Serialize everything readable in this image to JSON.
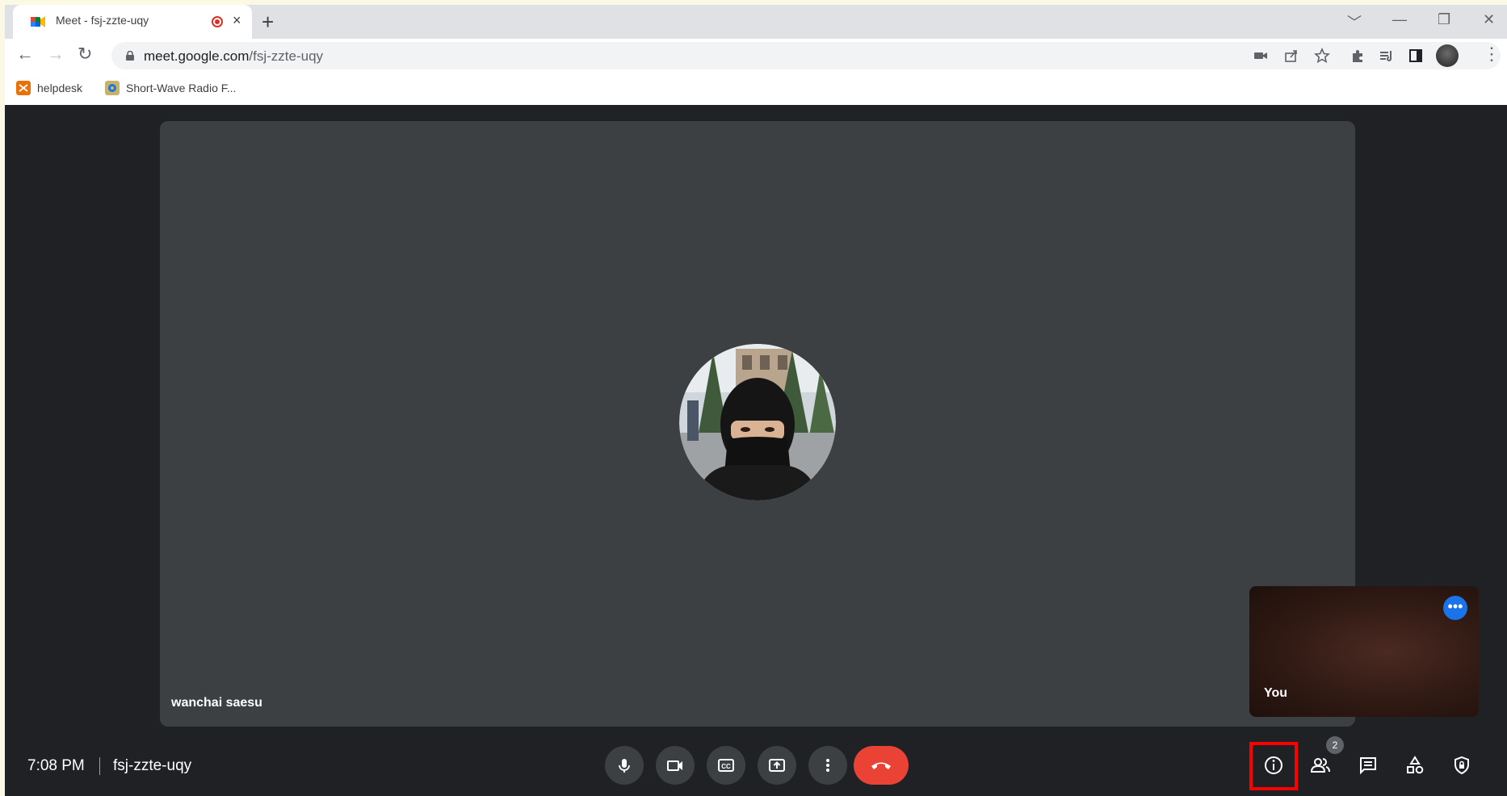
{
  "browser": {
    "tab_title": "Meet - fsj-zzte-uqy",
    "tab_close": "×",
    "new_tab": "+",
    "url_host": "meet.google.com",
    "url_path": "/fsj-zzte-uqy",
    "window_controls": [
      "﹀",
      "—",
      "❐",
      "✕"
    ]
  },
  "bookmarks": [
    {
      "label": "helpdesk",
      "icon": "helpdesk-icon",
      "color": "#e8710a"
    },
    {
      "label": "Short-Wave Radio F...",
      "icon": "radio-icon",
      "color": "#1a73e8"
    }
  ],
  "meeting": {
    "participant_name": "wanchai saesu",
    "self_label": "You",
    "time": "7:08 PM",
    "code": "fsj-zzte-uqy",
    "participants_count": "2"
  },
  "colors": {
    "accent": "#1a73e8",
    "end_call": "#ea4335",
    "highlight": "#ff0000",
    "background": "#202124",
    "tile": "#3c4043"
  }
}
